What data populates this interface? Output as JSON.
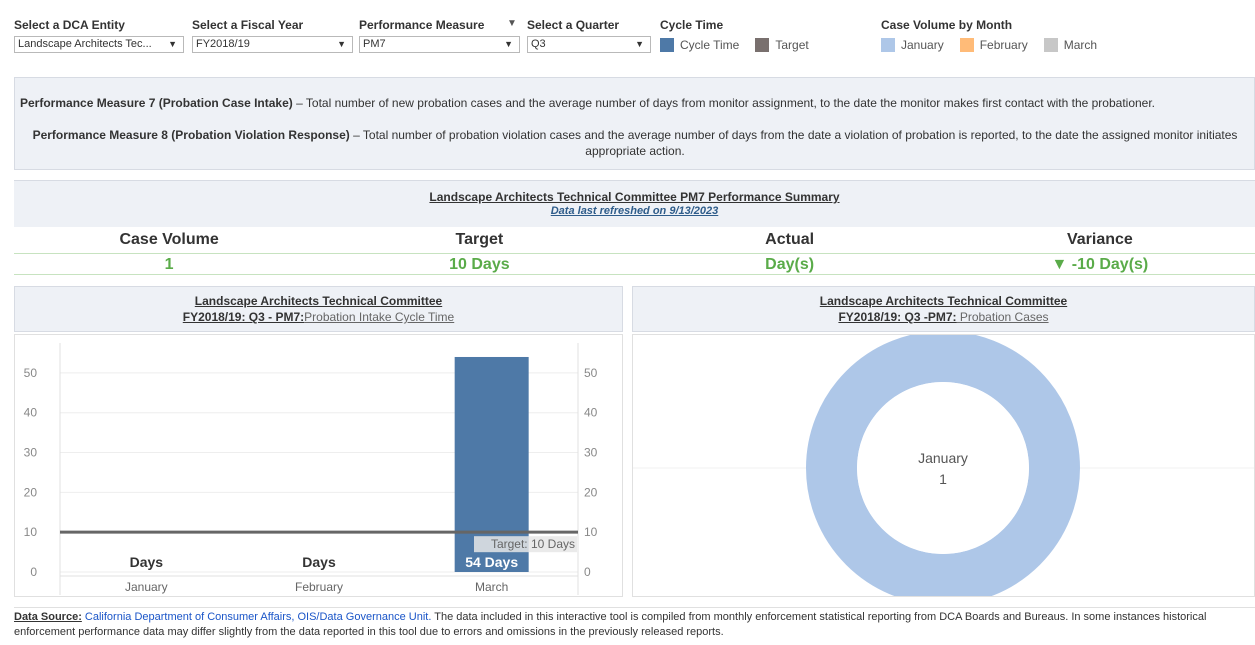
{
  "filters": {
    "entity": {
      "title": "Select a DCA Entity",
      "value": "Landscape Architects Tec..."
    },
    "fiscal_year": {
      "title": "Select a Fiscal Year",
      "value": "FY2018/19"
    },
    "measure": {
      "title": "Performance Measure",
      "value": "PM7"
    },
    "quarter": {
      "title": "Select a Quarter",
      "value": "Q3"
    },
    "cycle_legend": {
      "title": "Cycle Time",
      "items": [
        {
          "label": "Cycle Time",
          "color": "#4e79a7"
        },
        {
          "label": "Target",
          "color": "#79706e"
        }
      ]
    },
    "volume_legend": {
      "title": "Case Volume by Month",
      "items": [
        {
          "label": "January",
          "color": "#aec7e8"
        },
        {
          "label": "February",
          "color": "#ffbb78"
        },
        {
          "label": "March",
          "color": "#c7c7c7"
        }
      ]
    }
  },
  "description": {
    "pm7_name": "Performance Measure 7 (Probation Case Intake)",
    "pm7_text": " – Total number of new probation cases and the average number of days from monitor assignment, to the date the monitor makes first contact with the probationer.",
    "pm8_name": "Performance Measure 8 (Probation Violation Response)",
    "pm8_text": " – Total number of probation violation cases and the average number of days from the date a violation of probation is reported, to the date the assigned monitor initiates appropriate action."
  },
  "summary": {
    "title": "Landscape Architects Technical Committee PM7 Performance Summary",
    "refreshed": "Data last refreshed on 9/13/2023",
    "headers": [
      "Case Volume",
      "Target",
      "Actual",
      "Variance"
    ],
    "values": [
      "1",
      "10 Days",
      "Day(s)",
      "▼ -10 Day(s)"
    ]
  },
  "left_panel": {
    "title": "Landscape Architects Technical Committee",
    "sub_bold": "FY2018/19: Q3 -  PM7:",
    "sub_rest": "Probation Intake Cycle Time"
  },
  "right_panel": {
    "title": "Landscape Architects Technical Committee",
    "sub_bold": "FY2018/19: Q3 -PM7:",
    "sub_rest": " Probation Cases"
  },
  "chart_data": [
    {
      "type": "bar",
      "categories": [
        "January",
        "February",
        "March"
      ],
      "values": [
        0,
        0,
        54
      ],
      "bar_labels": [
        "Days",
        "Days",
        "54 Days"
      ],
      "target": 10,
      "target_label": "Target: 10 Days",
      "ylim": [
        0,
        55
      ],
      "yticks": [
        0,
        10,
        20,
        30,
        40,
        50
      ],
      "bar_color": "#4e79a7",
      "target_color": "#666666",
      "grid": true
    },
    {
      "type": "pie",
      "categories": [
        "January"
      ],
      "values": [
        1
      ],
      "colors": [
        "#aec7e8"
      ],
      "center_label": "January",
      "center_value": "1"
    }
  ],
  "footer": {
    "label": "Data Source:",
    "source": "California Department of Consumer Affairs, OIS/Data Governance Unit.",
    "text": " The data included in this interactive tool is compiled from monthly enforcement statistical reporting from DCA Boards and Bureaus.  In some instances historical enforcement performance data may differ slightly from the data reported in this tool due to errors and omissions in the previously released reports."
  }
}
